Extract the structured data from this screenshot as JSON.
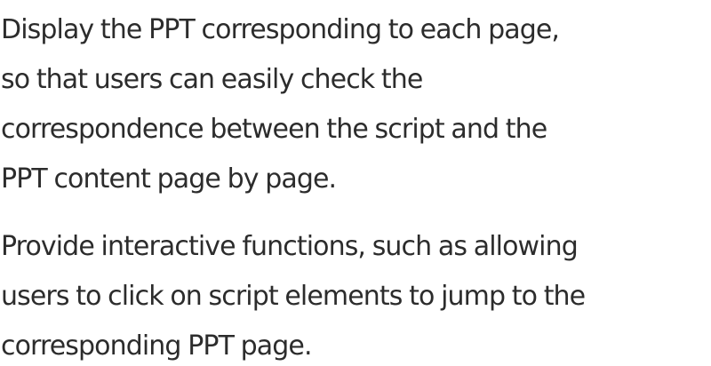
{
  "paragraphs": [
    {
      "lines": [
        "Display the PPT corresponding to each page,",
        "so that users can easily check the",
        "correspondence between the script and the",
        "PPT content page by page."
      ]
    },
    {
      "lines": [
        "Provide interactive functions, such as allowing",
        "users to click on script elements to jump to the",
        "corresponding PPT page."
      ]
    }
  ]
}
